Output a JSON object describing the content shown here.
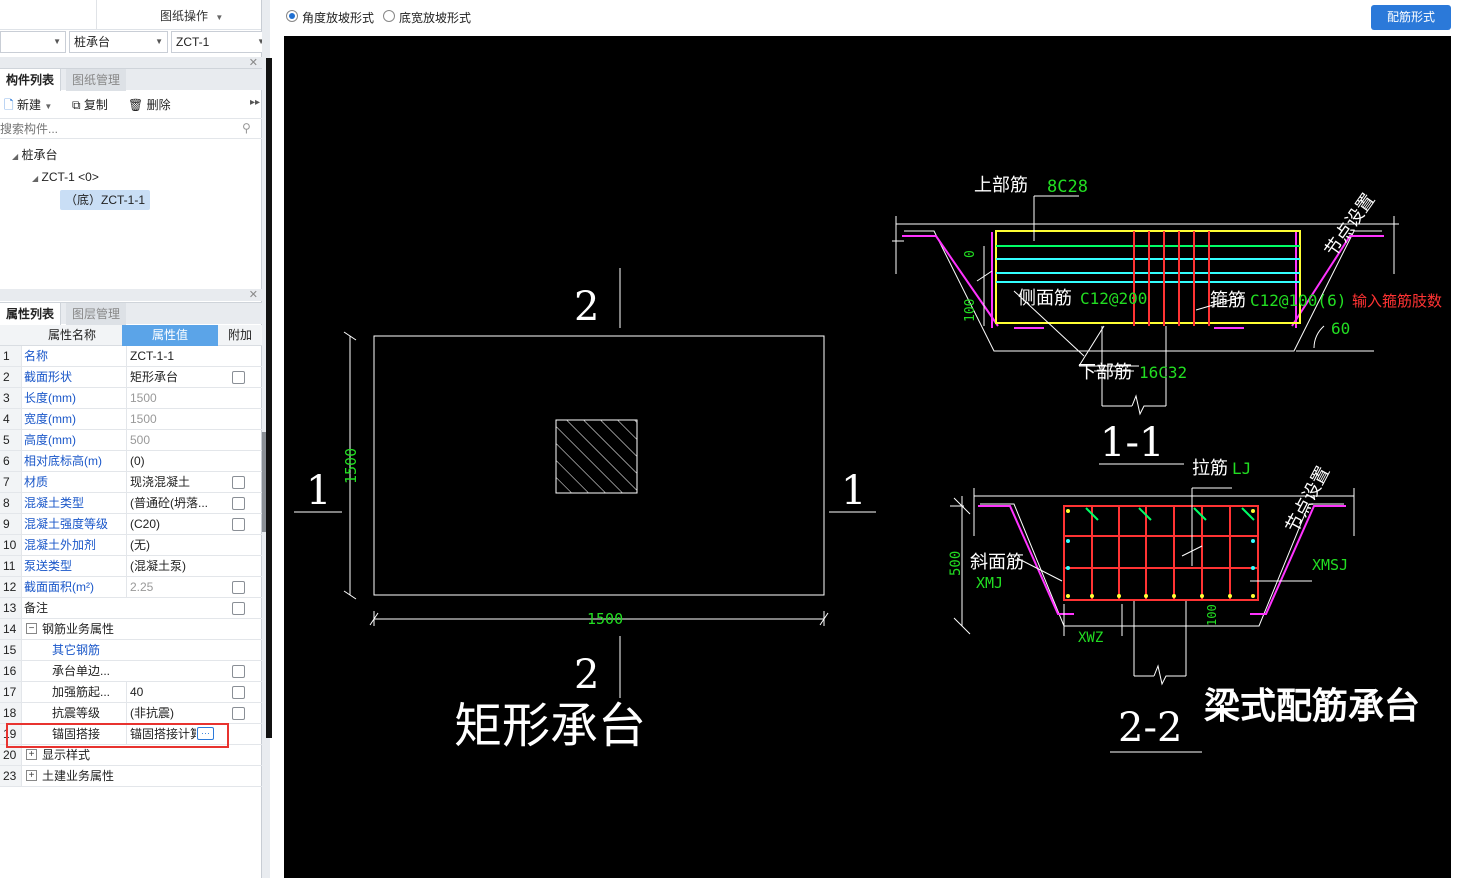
{
  "topbar": {
    "drawing_ops_label": "图纸操作"
  },
  "selectors": {
    "blank_value": "",
    "type_value": "桩承台",
    "name_value": "ZCT-1"
  },
  "component_panel": {
    "tabs": [
      "构件列表",
      "图纸管理"
    ],
    "toolbar": {
      "new_label": "新建",
      "copy_label": "复制",
      "delete_label": "删除"
    },
    "search_placeholder": "搜索构件...",
    "tree": {
      "root": "桩承台",
      "child": "ZCT-1 <0>",
      "leaf": "（底）ZCT-1-1"
    }
  },
  "property_panel": {
    "tabs": [
      "属性列表",
      "图层管理"
    ],
    "headers": {
      "name": "属性名称",
      "value": "属性值",
      "extra": "附加"
    },
    "rows": [
      {
        "num": "1",
        "name": "名称",
        "value": "ZCT-1-1",
        "blue": true,
        "check": false
      },
      {
        "num": "2",
        "name": "截面形状",
        "value": "矩形承台",
        "blue": true,
        "check": true
      },
      {
        "num": "3",
        "name": "长度(mm)",
        "value": "1500",
        "blue": true,
        "gray": true,
        "check": false
      },
      {
        "num": "4",
        "name": "宽度(mm)",
        "value": "1500",
        "blue": true,
        "gray": true,
        "check": false
      },
      {
        "num": "5",
        "name": "高度(mm)",
        "value": "500",
        "blue": true,
        "gray": true,
        "check": false
      },
      {
        "num": "6",
        "name": "相对底标高(m)",
        "value": "(0)",
        "blue": true,
        "check": false
      },
      {
        "num": "7",
        "name": "材质",
        "value": "现浇混凝土",
        "blue": true,
        "check": true
      },
      {
        "num": "8",
        "name": "混凝土类型",
        "value": "(普通砼(坍落...",
        "blue": true,
        "check": true
      },
      {
        "num": "9",
        "name": "混凝土强度等级",
        "value": "(C20)",
        "blue": true,
        "check": true
      },
      {
        "num": "10",
        "name": "混凝土外加剂",
        "value": "(无)",
        "blue": true,
        "check": false
      },
      {
        "num": "11",
        "name": "泵送类型",
        "value": "(混凝土泵)",
        "blue": true,
        "check": false
      },
      {
        "num": "12",
        "name": "截面面积(m²)",
        "value": "2.25",
        "blue": true,
        "gray": true,
        "check": true
      },
      {
        "num": "13",
        "name": "备注",
        "value": "",
        "check": true
      },
      {
        "num": "14",
        "name": "钢筋业务属性",
        "value": "",
        "expand": "−",
        "check": false
      },
      {
        "num": "15",
        "name": "其它钢筋",
        "value": "",
        "blue": true,
        "indent": true,
        "check": false
      },
      {
        "num": "16",
        "name": "承台单边...",
        "value": "",
        "indent": true,
        "check": true
      },
      {
        "num": "17",
        "name": "加强筋起...",
        "value": "40",
        "indent": true,
        "check": true
      },
      {
        "num": "18",
        "name": "抗震等级",
        "value": "(非抗震)",
        "indent": true,
        "check": true
      },
      {
        "num": "19",
        "name": "锚固搭接",
        "value": "锚固搭接计算",
        "indent": true,
        "check": false,
        "highlight": true
      },
      {
        "num": "20",
        "name": "显示样式",
        "value": "",
        "expand": "+",
        "check": false
      },
      {
        "num": "23",
        "name": "土建业务属性",
        "value": "",
        "expand": "+",
        "check": false
      }
    ]
  },
  "main": {
    "radio_options": [
      "角度放坡形式",
      "底宽放坡形式"
    ],
    "config_button": "配筋形式"
  },
  "drawing": {
    "plan": {
      "section_mark_top": "2",
      "section_mark_bottom": "2",
      "section_mark_left": "1",
      "section_mark_right": "1",
      "dim_width": "1500",
      "dim_height": "1500",
      "title": "矩形承台"
    },
    "section11": {
      "top_bar_label": "上部筋",
      "top_bar_value": "8C28",
      "node_label": "节点设置",
      "side_label": "侧面筋",
      "side_value": "C12@200",
      "stirrup_label": "箍筋",
      "stirrup_value": "C12@100(6)",
      "stirrup_hint": "输入箍筋肢数",
      "bottom_label": "下部筋",
      "bottom_value": "16C32",
      "angle": "60",
      "dim0": "0",
      "dim100": "100",
      "title": "1-1"
    },
    "section22": {
      "tie_label": "拉筋",
      "tie_value": "LJ",
      "node_label": "节点设置",
      "slope_label": "斜面筋",
      "slope_value": "XMJ",
      "xmsj": "XMSJ",
      "xwz": "XWZ",
      "height": "500",
      "dim100": "100",
      "title": "2-2"
    },
    "caption": "梁式配筋承台"
  }
}
